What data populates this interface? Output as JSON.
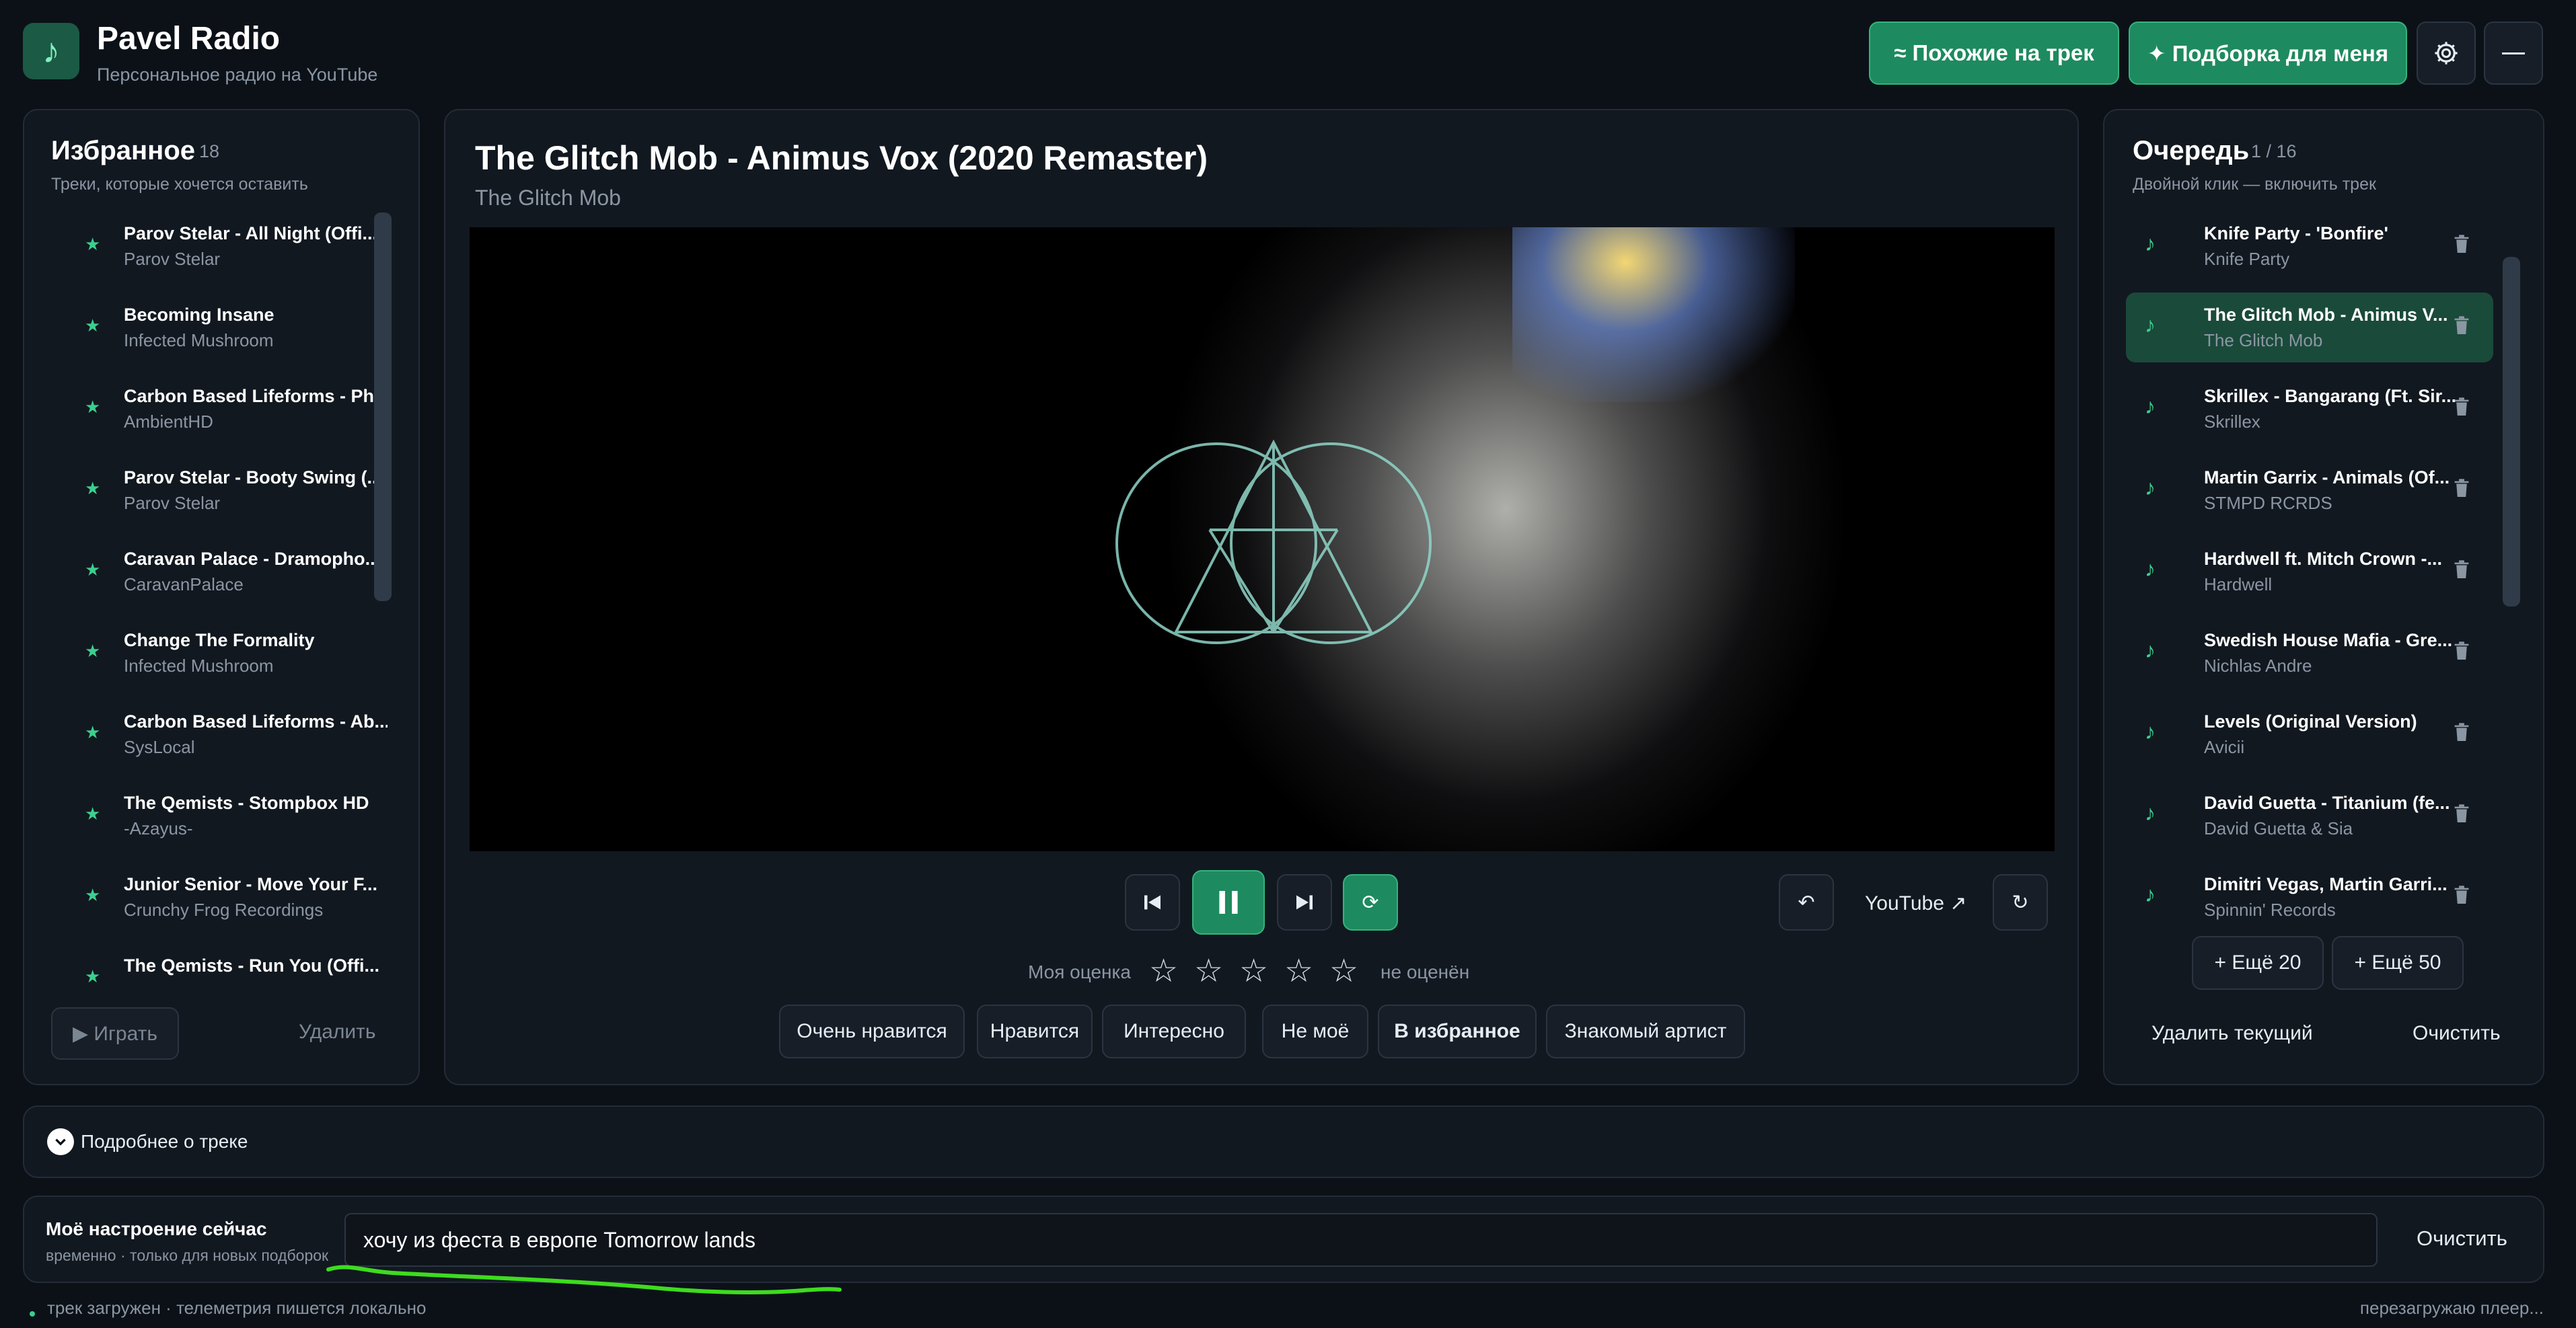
{
  "app": {
    "name": "Pavel Radio",
    "subtitle": "Персональное радио на YouTube"
  },
  "header": {
    "similar_label": "≈ Похожие на трек",
    "picks_label": "✦ Подборка для меня"
  },
  "favorites": {
    "title": "Избранное",
    "count": "18",
    "subtitle": "Треки, которые хочется оставить",
    "items": [
      {
        "title": "Parov Stelar - All Night (Offi...",
        "artist": "Parov Stelar"
      },
      {
        "title": "Becoming Insane",
        "artist": "Infected Mushroom"
      },
      {
        "title": "Carbon Based Lifeforms - Ph...",
        "artist": "AmbientHD"
      },
      {
        "title": "Parov Stelar - Booty Swing (...",
        "artist": "Parov Stelar"
      },
      {
        "title": "Caravan Palace - Dramopho...",
        "artist": "CaravanPalace"
      },
      {
        "title": "Change The Formality",
        "artist": "Infected Mushroom"
      },
      {
        "title": "Carbon Based Lifeforms - Ab...",
        "artist": "SysLocal"
      },
      {
        "title": "The Qemists - Stompbox HD",
        "artist": "-Azayus-"
      },
      {
        "title": "Junior Senior - Move Your F...",
        "artist": "Crunchy Frog Recordings"
      },
      {
        "title": "The Qemists - Run You (Offi...",
        "artist": ""
      }
    ],
    "play_label": "▶ Играть",
    "delete_label": "Удалить"
  },
  "player": {
    "track_title": "The Glitch Mob - Animus Vox (2020 Remaster)",
    "artist": "The Glitch Mob",
    "youtube_label": "YouTube ↗",
    "rating_label": "Моя оценка",
    "rating_status": "не оценён",
    "rating_value": 0,
    "rating_max": 5,
    "reactions": [
      "Очень нравится",
      "Нравится",
      "Интересно",
      "Не моё",
      "В избранное",
      "Знакомый артист"
    ],
    "active_reaction": "В избранное"
  },
  "queue": {
    "title": "Очередь",
    "position": "1 / 16",
    "subtitle": "Двойной клик — включить трек",
    "items": [
      {
        "title": "Knife Party - 'Bonfire'",
        "artist": "Knife Party"
      },
      {
        "title": "The Glitch Mob - Animus V...",
        "artist": "The Glitch Mob"
      },
      {
        "title": "Skrillex - Bangarang (Ft. Sir...",
        "artist": "Skrillex"
      },
      {
        "title": "Martin Garrix - Animals (Of...",
        "artist": "STMPD RCRDS"
      },
      {
        "title": "Hardwell ft. Mitch Crown -...",
        "artist": "Hardwell"
      },
      {
        "title": "Swedish House Mafia - Gre...",
        "artist": "Nichlas Andre"
      },
      {
        "title": "Levels (Original Version)",
        "artist": "Avicii"
      },
      {
        "title": "David Guetta - Titanium (fe...",
        "artist": "David Guetta & Sia"
      },
      {
        "title": "Dimitri Vegas, Martin Garri...",
        "artist": "Spinnin' Records"
      }
    ],
    "more20_label": "+ Ещё 20",
    "more50_label": "+ Ещё 50",
    "remove_current_label": "Удалить текущий",
    "clear_label": "Очистить"
  },
  "details": {
    "label": "Подробнее о треке"
  },
  "mood": {
    "title": "Моё настроение сейчас",
    "subtitle": "временно · только для новых подборок",
    "value": "хочу из феста в европе Tomorrow lands",
    "clear_label": "Очистить"
  },
  "status": {
    "left": "трек загружен · телеметрия пишется локально",
    "right": "перезагружаю плеер..."
  },
  "colors": {
    "accent": "#1e8a5f",
    "accent_border": "#34b47d",
    "background": "#0c1118",
    "panel": "#121820",
    "annotation_stroke": "#3ddc1e"
  }
}
